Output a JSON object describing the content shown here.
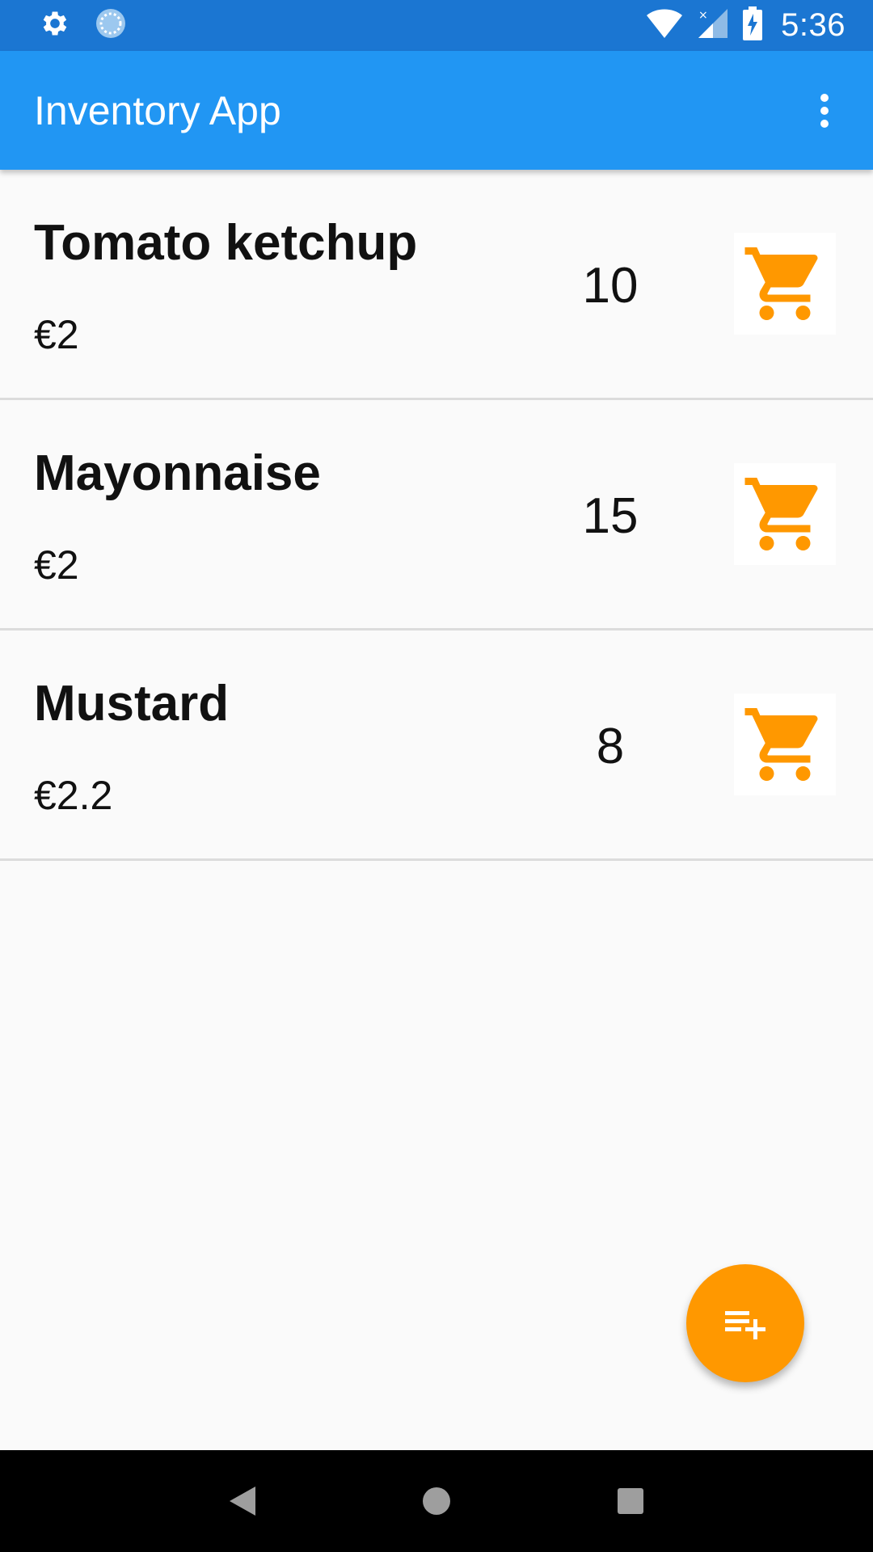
{
  "status_bar": {
    "time": "5:36",
    "icons": [
      "settings-icon",
      "sync-icon",
      "wifi-icon",
      "signal-icon",
      "battery-charging-icon"
    ]
  },
  "app_bar": {
    "title": "Inventory App",
    "overflow_icon": "more-vert-icon"
  },
  "products": [
    {
      "name": "Tomato ketchup",
      "price": "€2",
      "quantity": "10"
    },
    {
      "name": "Mayonnaise",
      "price": "€2",
      "quantity": "15"
    },
    {
      "name": "Mustard",
      "price": "€2.2",
      "quantity": "8"
    }
  ],
  "fab": {
    "icon": "playlist-add-icon"
  },
  "nav_bar": {
    "icons": [
      "back-icon",
      "home-icon",
      "recents-icon"
    ]
  },
  "colors": {
    "status_bar": "#1b76d2",
    "app_bar": "#2196f3",
    "accent": "#ff9800",
    "background": "#fafafa"
  }
}
